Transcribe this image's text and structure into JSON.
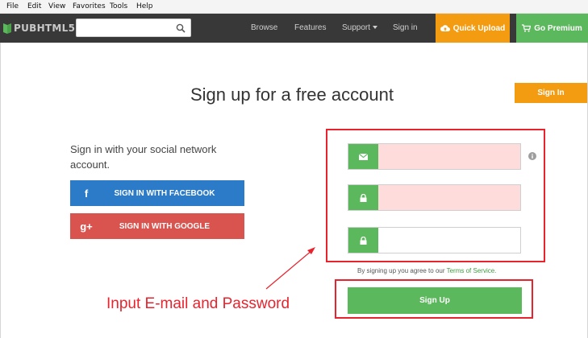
{
  "menubar": {
    "items": [
      "File",
      "Edit",
      "View",
      "Favorites",
      "Tools",
      "Help"
    ]
  },
  "header": {
    "logo_text": "PUBHTML5",
    "search": {
      "value": "",
      "placeholder": ""
    },
    "nav": {
      "browse": "Browse",
      "features": "Features",
      "support": "Support",
      "signin": "Sign in"
    },
    "quick_upload": "Quick Upload",
    "go_premium": "Go Premium"
  },
  "main": {
    "title": "Sign up for a free account",
    "signin_button": "Sign In",
    "social_prompt": "Sign in with your social network account.",
    "facebook_label": "SIGN IN WITH FACEBOOK",
    "google_label": "SIGN IN WITH GOOGLE",
    "facebook_icon": "f",
    "google_icon": "g+",
    "email_field": {
      "value": "",
      "placeholder": ""
    },
    "password_field": {
      "value": "",
      "placeholder": ""
    },
    "confirm_password_field": {
      "value": "",
      "placeholder": ""
    },
    "terms_prefix": "By signing up you agree to our",
    "terms_link": "Terms of Service.",
    "signup_button": "Sign Up"
  },
  "annotation": {
    "text": "Input E-mail and Password",
    "color": "#e8232d"
  },
  "colors": {
    "nav_bg": "#383838",
    "orange": "#f39c12",
    "green": "#5cb85c",
    "facebook": "#2b7bc8",
    "google": "#d9534f",
    "error_field": "#fedcdc"
  }
}
